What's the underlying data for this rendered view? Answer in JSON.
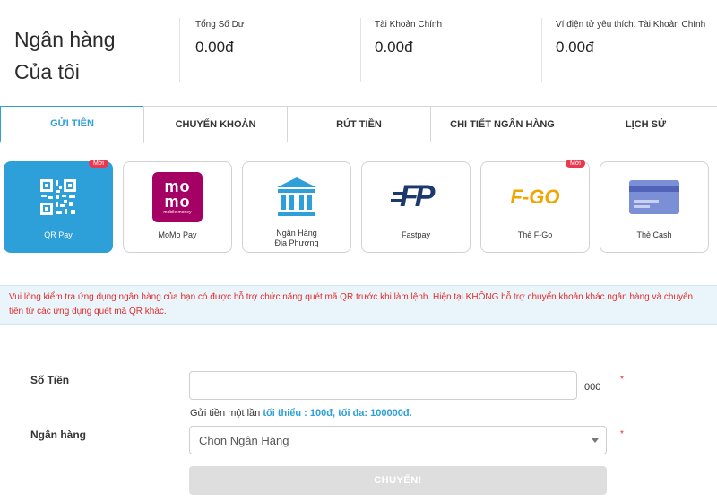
{
  "header": {
    "title_line1": "Ngân hàng",
    "title_line2": "Của tôi",
    "balances": [
      {
        "label": "Tổng Số Dư",
        "value": "0.00đ"
      },
      {
        "label": "Tài Khoản Chính",
        "value": "0.00đ"
      },
      {
        "label": "Ví điện tử yêu thích: Tài Khoản Chính",
        "value": "0.00đ"
      }
    ]
  },
  "tabs": [
    "GỬI TIỀN",
    "CHUYỂN KHOẢN",
    "RÚT TIỀN",
    "CHI TIẾT NGÂN HÀNG",
    "LỊCH SỬ"
  ],
  "methods": [
    {
      "label": "QR Pay",
      "badge": "Mới",
      "icon": "qr-code-icon"
    },
    {
      "label": "MoMo Pay",
      "icon": "momo-logo-icon",
      "logo_text_1": "mo",
      "logo_text_2": "mo",
      "logo_sub": "mobile money"
    },
    {
      "label_line1": "Ngân Hàng",
      "label_line2": "Địa Phương",
      "icon": "bank-icon"
    },
    {
      "label": "Fastpay",
      "icon": "fastpay-logo-icon",
      "logo_text": "FP"
    },
    {
      "label": "Thẻ F-Go",
      "badge": "Mới",
      "icon": "fgo-logo-icon",
      "logo_text": "F-GO"
    },
    {
      "label": "Thẻ Cash",
      "icon": "card-icon"
    }
  ],
  "notice": "Vui lòng kiểm tra ứng dụng ngân hàng của bạn có được hỗ trợ chức năng quét mã QR trước khi làm lệnh. Hiện tại KHÔNG hỗ trợ chuyển khoản khác ngân hàng và chuyển tiền từ các ứng dụng quét mã QR khác.",
  "form": {
    "amount_label": "Số Tiền",
    "amount_value": "",
    "amount_suffix": ",000",
    "required_mark": "*",
    "hint_prefix": "Gửi tiền một lần",
    "hint_limits": "tối thiểu : 100đ, tối đa: 100000đ.",
    "bank_label": "Ngân hàng",
    "bank_placeholder": "Chọn Ngân Hàng",
    "submit_label": "CHUYỂN!"
  },
  "colors": {
    "accent": "#2d9fd9",
    "warning": "#e22a2a",
    "badge": "#e8394f",
    "momo": "#a50064"
  }
}
